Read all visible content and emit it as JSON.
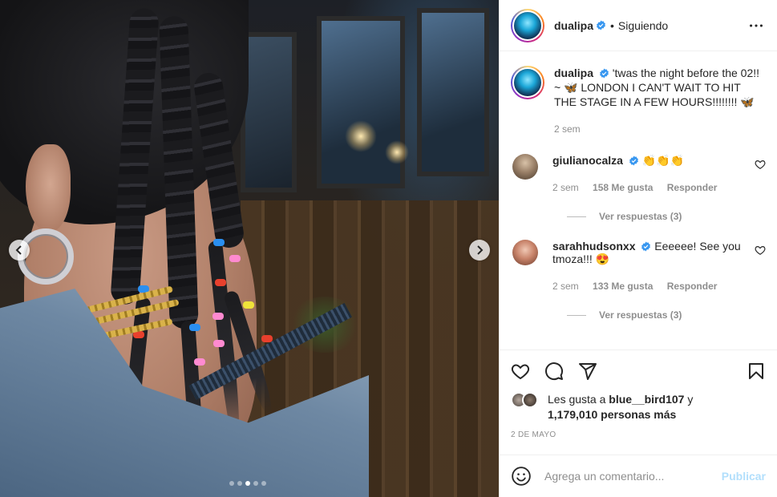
{
  "post": {
    "author": "dualipa",
    "follow_status": "Siguiendo",
    "caption": "'twas the night before the 02!! ~ 🦋 LONDON I CAN'T WAIT TO HIT THE STAGE IN A FEW HOURS!!!!!!!! 🦋",
    "caption_time": "2 sem",
    "date": "2 DE MAYO",
    "carousel": {
      "slide_count": 5,
      "active_index": 2
    }
  },
  "comments": [
    {
      "username": "giulianocalza",
      "text": "👏👏👏",
      "time": "2 sem",
      "likes": "158 Me gusta",
      "reply_label": "Responder",
      "view_replies": "Ver respuestas (3)"
    },
    {
      "username": "sarahhudsonxx",
      "text": "Eeeeee! See you tmoza!!! 😍",
      "time": "2 sem",
      "likes": "133 Me gusta",
      "reply_label": "Responder",
      "view_replies": "Ver respuestas (3)"
    }
  ],
  "likes": {
    "prefix": "Les gusta a ",
    "user": "blue__bird107",
    "conj": " y",
    "others": "1,179,010 personas más"
  },
  "add_comment": {
    "placeholder": "Agrega un comentario...",
    "publish_label": "Publicar"
  },
  "icons": {
    "more": "more-icon",
    "like": "heart-icon",
    "comment": "comment-icon",
    "share": "share-icon",
    "save": "bookmark-icon",
    "emoji": "emoji-icon",
    "verified": "verified-badge-icon"
  },
  "colors": {
    "verified": "#3897f0",
    "publish_disabled": "#b2dffc",
    "muted_text": "#8e8e8e"
  }
}
